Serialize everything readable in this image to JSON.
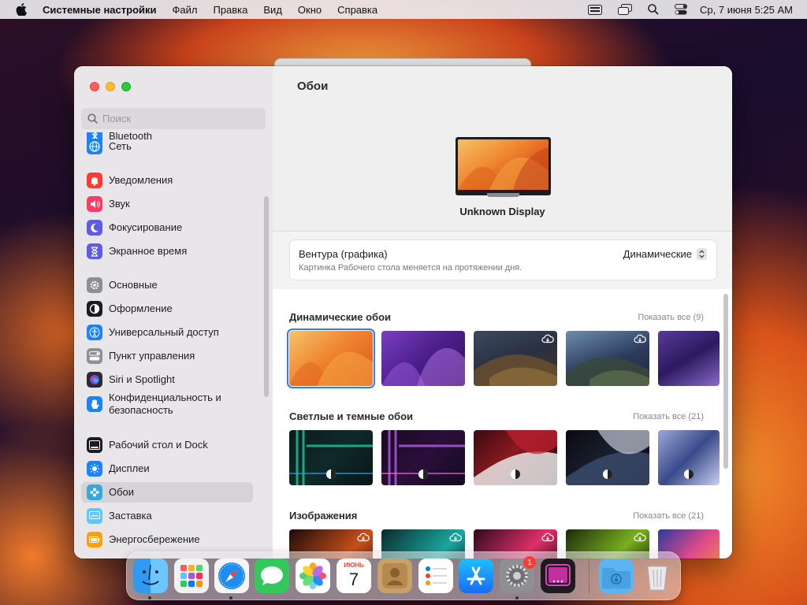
{
  "menubar": {
    "app": "Системные настройки",
    "items": [
      "Файл",
      "Правка",
      "Вид",
      "Окно",
      "Справка"
    ],
    "datetime": "Ср, 7 июня  5:25 AM"
  },
  "sidebar": {
    "search_placeholder": "Поиск",
    "items": [
      {
        "label": "Bluetooth",
        "icon": "bluetooth-icon",
        "color": "#1a82fb"
      },
      {
        "label": "Сеть",
        "icon": "globe-icon",
        "color": "#1a82fb"
      },
      {
        "label": "Уведомления",
        "icon": "bell-icon",
        "color": "#fe3b30"
      },
      {
        "label": "Звук",
        "icon": "speaker-icon",
        "color": "#fe3b63"
      },
      {
        "label": "Фокусирование",
        "icon": "moon-icon",
        "color": "#5e5ce6"
      },
      {
        "label": "Экранное время",
        "icon": "hourglass-icon",
        "color": "#5e5ce6"
      },
      {
        "label": "Основные",
        "icon": "gear-icon",
        "color": "#8e8e93"
      },
      {
        "label": "Оформление",
        "icon": "appearance-icon",
        "color": "#1c1c1e"
      },
      {
        "label": "Универсальный доступ",
        "icon": "accessibility-icon",
        "color": "#1a82fb"
      },
      {
        "label": "Пункт управления",
        "icon": "control-center-icon",
        "color": "#8e8e93"
      },
      {
        "label": "Siri и Spotlight",
        "icon": "siri-icon",
        "color": "#2b2b2e"
      },
      {
        "label": "Конфиденциальность и безопасность",
        "icon": "hand-icon",
        "color": "#1a82fb"
      },
      {
        "label": "Рабочий стол и Dock",
        "icon": "dock-icon",
        "color": "#1c1c1e"
      },
      {
        "label": "Дисплеи",
        "icon": "sun-icon",
        "color": "#1a82fb"
      },
      {
        "label": "Обои",
        "icon": "wallpaper-icon",
        "color": "#34aadc"
      },
      {
        "label": "Заставка",
        "icon": "screensaver-icon",
        "color": "#5ac8fa"
      },
      {
        "label": "Энергосбережение",
        "icon": "battery-icon",
        "color": "#ff9f0a"
      }
    ]
  },
  "content": {
    "title": "Обои",
    "display_name": "Unknown Display",
    "current": {
      "title": "Вентура (графика)",
      "subtitle": "Картинка Рабочего стола меняется на протяжении дня.",
      "mode": "Динамические"
    },
    "sections": [
      {
        "title": "Динамические обои",
        "link": "Показать все (9)"
      },
      {
        "title": "Светлые и темные обои",
        "link": "Показать все (21)"
      },
      {
        "title": "Изображения",
        "link": "Показать все (21)"
      }
    ]
  },
  "dock": {
    "calendar_month": "ИЮНЬ",
    "calendar_day": "7",
    "settings_badge": "1",
    "apps": [
      "finder-icon",
      "launchpad-icon",
      "safari-icon",
      "messages-icon",
      "photos-icon",
      "calendar-icon",
      "contacts-icon",
      "reminders-icon",
      "appstore-icon",
      "settings-icon",
      "screensaver-app-icon",
      "downloads-folder-icon",
      "trash-icon"
    ]
  }
}
